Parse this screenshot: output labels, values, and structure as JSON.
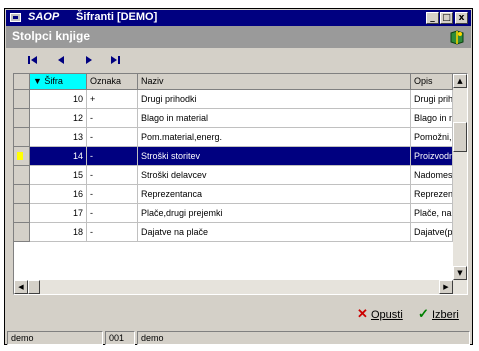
{
  "window": {
    "title_brand": "SAOP",
    "title_rest": "Šifranti [DEMO]",
    "min_glyph": "_",
    "max_glyph": "□",
    "close_glyph": "x"
  },
  "header": {
    "title": "Stolpci knjige",
    "help_icon": "help-book-icon"
  },
  "navigation": {
    "first_icon": "first-record-icon",
    "prev_icon": "previous-record-icon",
    "next_icon": "next-record-icon",
    "last_icon": "last-record-icon"
  },
  "grid": {
    "columns": [
      "▼ Šifra",
      "Oznaka",
      "Naziv",
      "Opis"
    ],
    "selected_row_index": 3,
    "rows": [
      {
        "sifra": "10",
        "oznaka": "+",
        "naziv": "Drugi prihodki",
        "opis": "Drugi prih"
      },
      {
        "sifra": "12",
        "oznaka": "-",
        "naziv": "Blago in material",
        "opis": "Blago in n"
      },
      {
        "sifra": "13",
        "oznaka": "-",
        "naziv": "Pom.material,energ.",
        "opis": "Pomožni,p"
      },
      {
        "sifra": "14",
        "oznaka": "-",
        "naziv": "Stroški storitev",
        "opis": "Proizvodn"
      },
      {
        "sifra": "15",
        "oznaka": "-",
        "naziv": "Stroški delavcev",
        "opis": "Nadomes"
      },
      {
        "sifra": "16",
        "oznaka": "-",
        "naziv": "Reprezentanca",
        "opis": "Reprezen"
      },
      {
        "sifra": "17",
        "oznaka": "-",
        "naziv": "Plače,drugi prejemki",
        "opis": "Plače, na"
      },
      {
        "sifra": "18",
        "oznaka": "-",
        "naziv": "Dajatve na plače",
        "opis": "Dajatve(p"
      }
    ]
  },
  "footer": {
    "cancel_label": "Opusti",
    "select_label": "Izberi",
    "cancel_color": "#cc0000",
    "select_color": "#008000"
  },
  "status": {
    "user": "demo",
    "company_code": "001",
    "company_name": "demo"
  }
}
